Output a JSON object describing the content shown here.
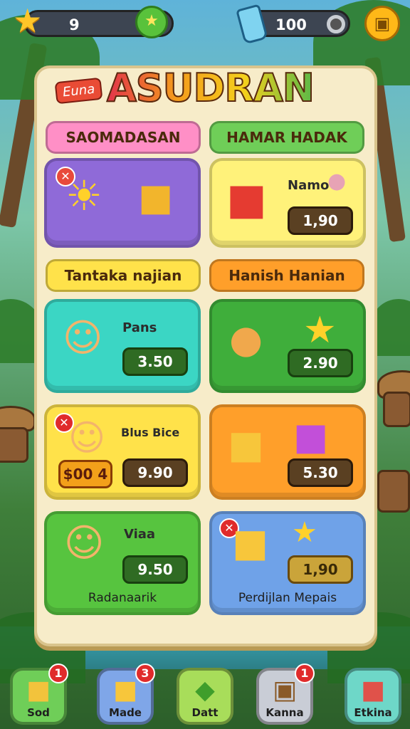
{
  "topbar": {
    "stars_value": "9",
    "coins_value": "100",
    "icons": [
      "star-icon",
      "gem-icon",
      "potion-icon",
      "ring-icon",
      "shop-icon"
    ]
  },
  "logo": {
    "tag": "Euna",
    "title": "ASUDRAN"
  },
  "headers": {
    "row1_left": "SAOMADASAN",
    "row1_right": "HAMAR HADAK",
    "row2_left": "Tantaka najian",
    "row2_right": "Hanish Hanian"
  },
  "cards": {
    "gift": {
      "name": "Namo",
      "price": "1,90"
    },
    "pans": {
      "name": "Pans",
      "price": "3.50"
    },
    "starbox": {
      "price": "2.90"
    },
    "blue_bice": {
      "name": "Blus Bice",
      "sale_tag": "$00 4",
      "price": "9.90"
    },
    "cake": {
      "price": "5.30"
    },
    "viaa": {
      "name": "Viaa",
      "price": "9.50",
      "footer": "Radanaarik"
    },
    "dessert": {
      "price": "1,90",
      "footer": "Perdijlan Mepais"
    }
  },
  "nav": [
    {
      "label": "Sod",
      "badge": "1",
      "icon": "crate-icon"
    },
    {
      "label": "Made",
      "badge": "3",
      "icon": "cube-icon"
    },
    {
      "label": "Datt",
      "badge": "",
      "icon": "leaf-icon"
    },
    {
      "label": "Kanna",
      "badge": "1",
      "icon": "frame-icon"
    },
    {
      "label": "Etkina",
      "badge": "",
      "icon": "block-icon"
    }
  ],
  "colors": {
    "panel": "#f7ecc9",
    "accent": "#ffc629",
    "badge": "#e02b2b"
  }
}
